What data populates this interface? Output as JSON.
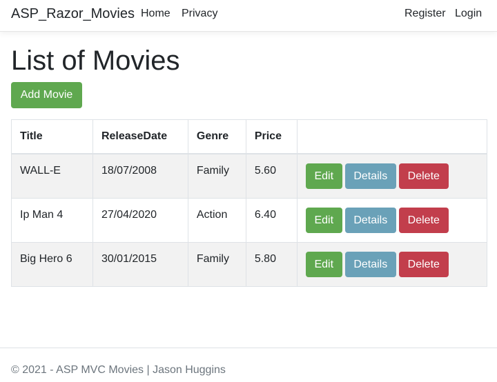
{
  "navbar": {
    "brand": "ASP_Razor_Movies",
    "links": [
      "Home",
      "Privacy"
    ],
    "auth_links": [
      "Register",
      "Login"
    ]
  },
  "page": {
    "title": "List of Movies",
    "add_button": "Add Movie"
  },
  "table": {
    "headers": [
      "Title",
      "ReleaseDate",
      "Genre",
      "Price",
      ""
    ],
    "rows": [
      {
        "title": "WALL-E",
        "release_date": "18/07/2008",
        "genre": "Family",
        "price": "5.60"
      },
      {
        "title": "Ip Man 4",
        "release_date": "27/04/2020",
        "genre": "Action",
        "price": "6.40"
      },
      {
        "title": "Big Hero 6",
        "release_date": "30/01/2015",
        "genre": "Family",
        "price": "5.80"
      }
    ],
    "actions": {
      "edit": "Edit",
      "details": "Details",
      "delete": "Delete"
    }
  },
  "footer": {
    "text": "© 2021 - ASP MVC Movies | Jason Huggins"
  },
  "colors": {
    "success": "#5fa84f",
    "info": "#6aa1b8",
    "danger": "#c23e4c"
  }
}
